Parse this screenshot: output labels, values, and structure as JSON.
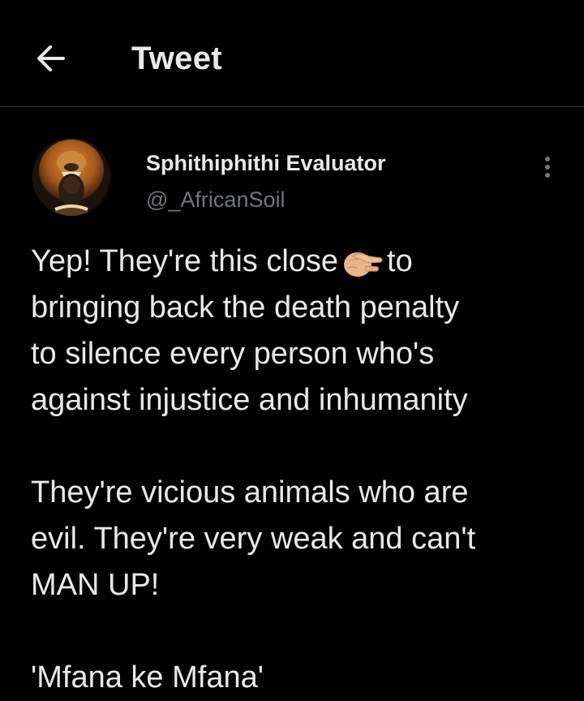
{
  "header": {
    "title": "Tweet",
    "back_icon": "arrow-left-icon"
  },
  "author": {
    "display_name": "Sphithiphithi Evaluator",
    "handle": "@_AfricanSoil",
    "avatar_icon": "lion-headdress-avatar"
  },
  "more_icon": "vertical-ellipsis-icon",
  "tweet": {
    "line1_before": "Yep! They're this close",
    "emoji": "pinching-hand-emoji",
    "line1_after": "to",
    "para1_rest": "bringing back the death penalty\nto silence every person who's\nagainst injustice and inhumanity",
    "para2": "They're vicious animals who are\nevil. They're very weak and can't\nMAN UP!",
    "para3": "'Mfana ke Mfana'"
  },
  "colors": {
    "background": "#000000",
    "text": "#e7e9ea",
    "secondary": "#71767b",
    "divider": "#2f3336"
  }
}
